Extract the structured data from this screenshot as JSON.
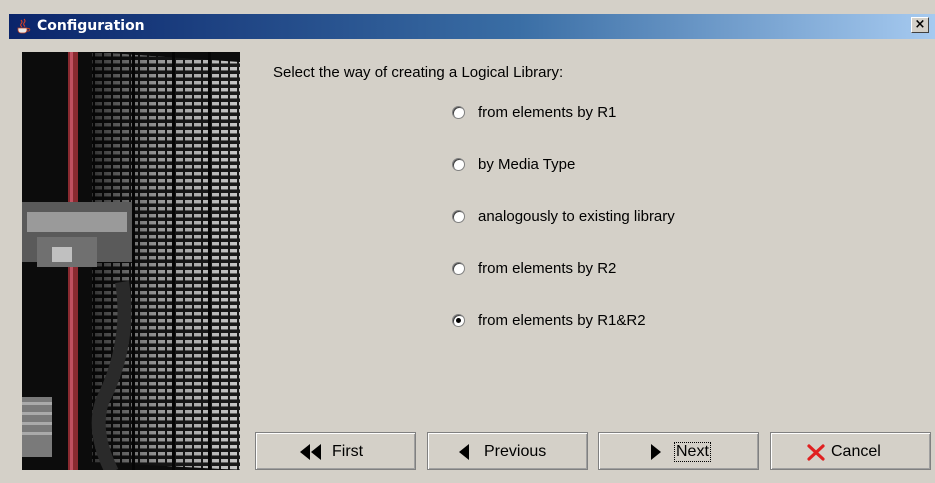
{
  "window": {
    "title": "Configuration",
    "close_glyph": "×"
  },
  "prompt": "Select the way of creating a Logical Library:",
  "options": [
    {
      "label": "from elements by R1",
      "selected": false
    },
    {
      "label": "by Media Type",
      "selected": false
    },
    {
      "label": "analogously to existing library",
      "selected": false
    },
    {
      "label": "from elements by R2",
      "selected": false
    },
    {
      "label": "from elements by R1&R2",
      "selected": true
    }
  ],
  "buttons": {
    "first": "First",
    "previous": "Previous",
    "next": "Next",
    "cancel": "Cancel"
  },
  "icons": {
    "title": "java-coffee-icon",
    "first": "double-left-arrow-icon",
    "previous": "left-arrow-icon",
    "next": "right-arrow-icon",
    "cancel": "red-x-icon"
  },
  "colors": {
    "title_bar_start": "#0a246a",
    "title_bar_end": "#a6caf0",
    "window_bg": "#d4d0c8",
    "cancel_icon": "#e02020"
  }
}
